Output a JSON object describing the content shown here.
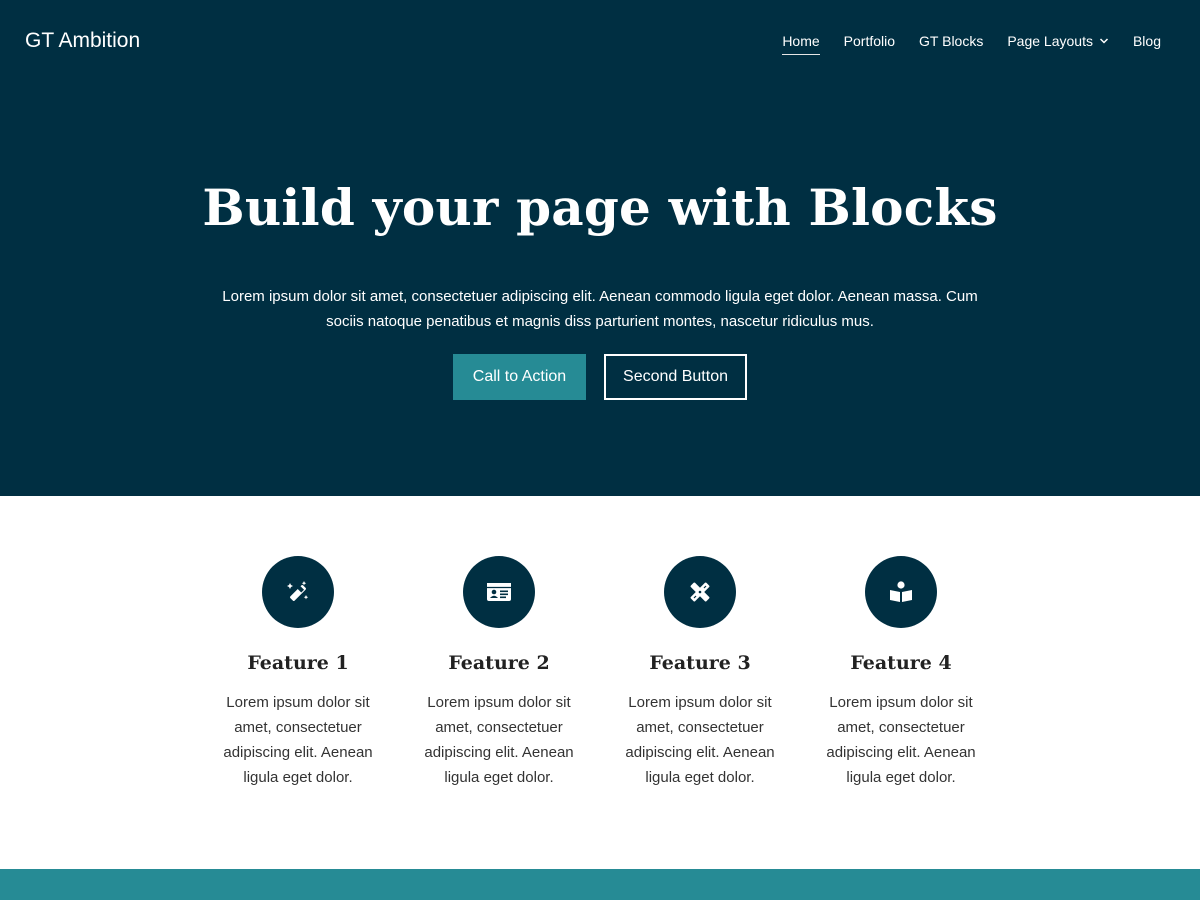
{
  "site": {
    "title": "GT Ambition"
  },
  "nav": {
    "items": [
      {
        "label": "Home",
        "active": true
      },
      {
        "label": "Portfolio"
      },
      {
        "label": "GT Blocks"
      },
      {
        "label": "Page Layouts",
        "dropdown": true
      },
      {
        "label": "Blog"
      }
    ]
  },
  "hero": {
    "title": "Build your page with Blocks",
    "text": "Lorem ipsum dolor sit amet, consectetuer adipiscing elit. Aenean commodo ligula eget dolor. Aenean massa. Cum sociis natoque penatibus et magnis diss parturient montes, nascetur ridiculus mus.",
    "primary_button": "Call to Action",
    "secondary_button": "Second Button"
  },
  "features": [
    {
      "title": "Feature 1",
      "text": "Lorem ipsum dolor sit amet, consectetuer adipiscing elit. Aenean ligula eget dolor.",
      "icon": "magic-wand-icon"
    },
    {
      "title": "Feature 2",
      "text": "Lorem ipsum dolor sit amet, consectetuer adipiscing elit. Aenean ligula eget dolor.",
      "icon": "id-card-icon"
    },
    {
      "title": "Feature 3",
      "text": "Lorem ipsum dolor sit amet, consectetuer adipiscing elit. Aenean ligula eget dolor.",
      "icon": "pencil-ruler-icon"
    },
    {
      "title": "Feature 4",
      "text": "Lorem ipsum dolor sit amet, consectetuer adipiscing elit. Aenean ligula eget dolor.",
      "icon": "reader-icon"
    }
  ],
  "colors": {
    "hero_background": "#002f42",
    "accent": "#268b95",
    "icon_circle": "#002f42",
    "white": "#ffffff"
  }
}
